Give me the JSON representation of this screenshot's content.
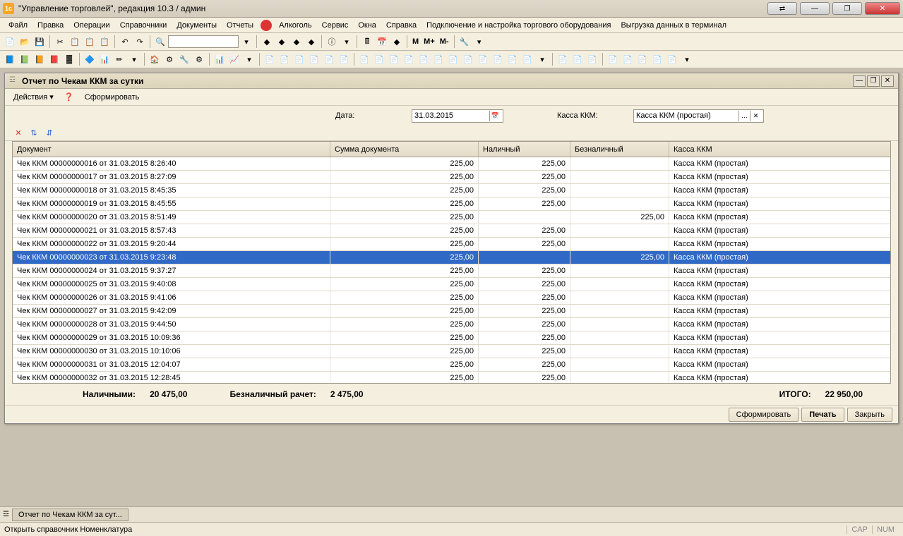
{
  "app": {
    "title": "\"Управление торговлей\", редакция 10.3 / админ"
  },
  "menu": {
    "items": [
      "Файл",
      "Правка",
      "Операции",
      "Справочники",
      "Документы",
      "Отчеты",
      "Алкоголь",
      "Сервис",
      "Окна",
      "Справка",
      "Подключение и настройка торгового оборудования",
      "Выгрузка данных в терминал"
    ]
  },
  "inner": {
    "title": "Отчет по Чекам ККМ за сутки",
    "actions_label": "Действия",
    "form_label": "Сформировать"
  },
  "filter": {
    "date_label": "Дата:",
    "date_value": "31.03.2015",
    "kkm_label": "Касса ККМ:",
    "kkm_value": "Касса ККМ (простая)"
  },
  "table": {
    "headers": [
      "Документ",
      "Сумма документа",
      "Наличный",
      "Безналичный",
      "Касса ККМ"
    ],
    "rows": [
      {
        "doc": "Чек ККМ 00000000016 от 31.03.2015 8:26:40",
        "sum": "225,00",
        "cash": "225,00",
        "noncash": "",
        "kkm": "Касса ККМ (простая)",
        "sel": false
      },
      {
        "doc": "Чек ККМ 00000000017 от 31.03.2015 8:27:09",
        "sum": "225,00",
        "cash": "225,00",
        "noncash": "",
        "kkm": "Касса ККМ (простая)",
        "sel": false
      },
      {
        "doc": "Чек ККМ 00000000018 от 31.03.2015 8:45:35",
        "sum": "225,00",
        "cash": "225,00",
        "noncash": "",
        "kkm": "Касса ККМ (простая)",
        "sel": false
      },
      {
        "doc": "Чек ККМ 00000000019 от 31.03.2015 8:45:55",
        "sum": "225,00",
        "cash": "225,00",
        "noncash": "",
        "kkm": "Касса ККМ (простая)",
        "sel": false
      },
      {
        "doc": "Чек ККМ 00000000020 от 31.03.2015 8:51:49",
        "sum": "225,00",
        "cash": "",
        "noncash": "225,00",
        "kkm": "Касса ККМ (простая)",
        "sel": false
      },
      {
        "doc": "Чек ККМ 00000000021 от 31.03.2015 8:57:43",
        "sum": "225,00",
        "cash": "225,00",
        "noncash": "",
        "kkm": "Касса ККМ (простая)",
        "sel": false
      },
      {
        "doc": "Чек ККМ 00000000022 от 31.03.2015 9:20:44",
        "sum": "225,00",
        "cash": "225,00",
        "noncash": "",
        "kkm": "Касса ККМ (простая)",
        "sel": false
      },
      {
        "doc": "Чек ККМ 00000000023 от 31.03.2015 9:23:48",
        "sum": "225,00",
        "cash": "",
        "noncash": "225,00",
        "kkm": "Касса ККМ (простая)",
        "sel": true
      },
      {
        "doc": "Чек ККМ 00000000024 от 31.03.2015 9:37:27",
        "sum": "225,00",
        "cash": "225,00",
        "noncash": "",
        "kkm": "Касса ККМ (простая)",
        "sel": false
      },
      {
        "doc": "Чек ККМ 00000000025 от 31.03.2015 9:40:08",
        "sum": "225,00",
        "cash": "225,00",
        "noncash": "",
        "kkm": "Касса ККМ (простая)",
        "sel": false
      },
      {
        "doc": "Чек ККМ 00000000026 от 31.03.2015 9:41:06",
        "sum": "225,00",
        "cash": "225,00",
        "noncash": "",
        "kkm": "Касса ККМ (простая)",
        "sel": false
      },
      {
        "doc": "Чек ККМ 00000000027 от 31.03.2015 9:42:09",
        "sum": "225,00",
        "cash": "225,00",
        "noncash": "",
        "kkm": "Касса ККМ (простая)",
        "sel": false
      },
      {
        "doc": "Чек ККМ 00000000028 от 31.03.2015 9:44:50",
        "sum": "225,00",
        "cash": "225,00",
        "noncash": "",
        "kkm": "Касса ККМ (простая)",
        "sel": false
      },
      {
        "doc": "Чек ККМ 00000000029 от 31.03.2015 10:09:36",
        "sum": "225,00",
        "cash": "225,00",
        "noncash": "",
        "kkm": "Касса ККМ (простая)",
        "sel": false
      },
      {
        "doc": "Чек ККМ 00000000030 от 31.03.2015 10:10:06",
        "sum": "225,00",
        "cash": "225,00",
        "noncash": "",
        "kkm": "Касса ККМ (простая)",
        "sel": false
      },
      {
        "doc": "Чек ККМ 00000000031 от 31.03.2015 12:04:07",
        "sum": "225,00",
        "cash": "225,00",
        "noncash": "",
        "kkm": "Касса ККМ (простая)",
        "sel": false
      },
      {
        "doc": "Чек ККМ 00000000032 от 31.03.2015 12:28:45",
        "sum": "225,00",
        "cash": "225,00",
        "noncash": "",
        "kkm": "Касса ККМ (простая)",
        "sel": false
      }
    ]
  },
  "totals": {
    "cash_label": "Наличными:",
    "cash_value": "20 475,00",
    "noncash_label": "Безналичный рачет:",
    "noncash_value": "2 475,00",
    "total_label": "ИТОГО:",
    "total_value": "22 950,00"
  },
  "footer": {
    "form": "Сформировать",
    "print": "Печать",
    "close": "Закрыть"
  },
  "taskbar": {
    "item": "Отчет по Чекам ККМ за сут..."
  },
  "status": {
    "text": "Открыть справочник Номенклатура",
    "cap": "CAP",
    "num": "NUM"
  }
}
